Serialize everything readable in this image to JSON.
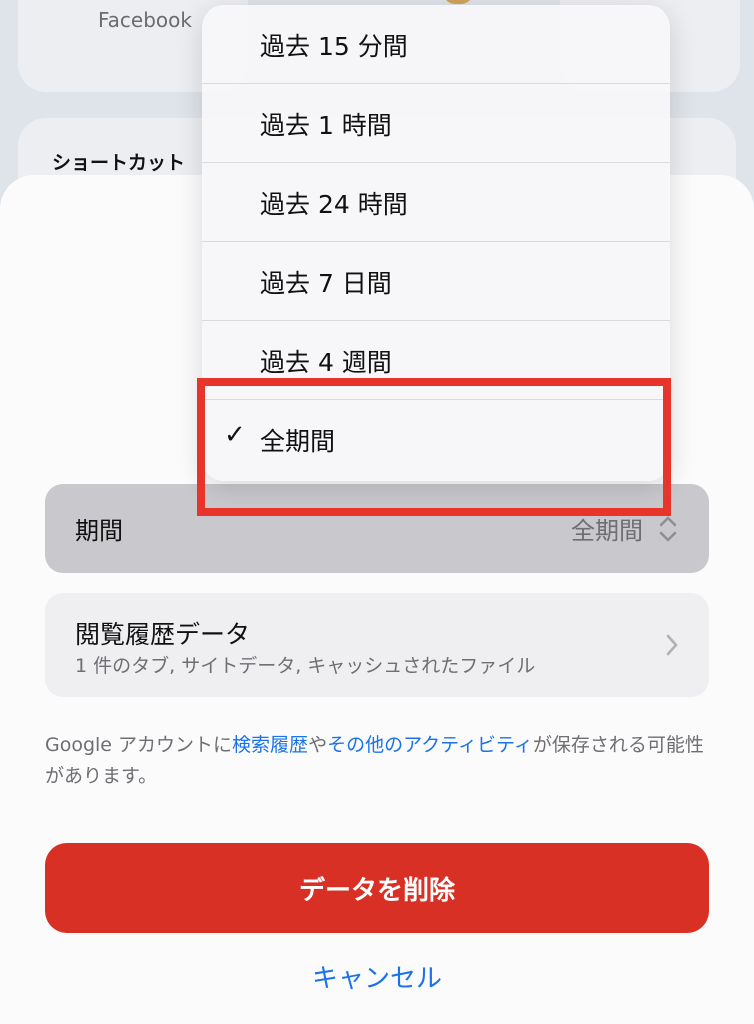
{
  "background": {
    "app_tile_label": "Facebook",
    "section_label": "ショートカット"
  },
  "dropdown": {
    "items": [
      {
        "label": "過去 15 分間",
        "checked": false
      },
      {
        "label": "過去 1 時間",
        "checked": false
      },
      {
        "label": "過去 24 時間",
        "checked": false
      },
      {
        "label": "過去 7 日間",
        "checked": false
      },
      {
        "label": "過去 4 週間",
        "checked": false
      },
      {
        "label": "全期間",
        "checked": true
      }
    ],
    "check_mark": "✓"
  },
  "period_row": {
    "label": "期間",
    "value": "全期間"
  },
  "history_row": {
    "title": "閲覧履歴データ",
    "subtitle": "1 件のタブ, サイトデータ, キャッシュされたファイル"
  },
  "notice": {
    "prefix": "Google アカウントに",
    "link1": "検索履歴",
    "middle": "や",
    "link2": "その他のアクティビティ",
    "suffix": "が保存される可能性があります。"
  },
  "buttons": {
    "delete_label": "データを削除",
    "cancel_label": "キャンセル"
  },
  "colors": {
    "accent_blue": "#1a73e8",
    "delete_red": "#d93025",
    "highlight_red": "#e8352b"
  }
}
